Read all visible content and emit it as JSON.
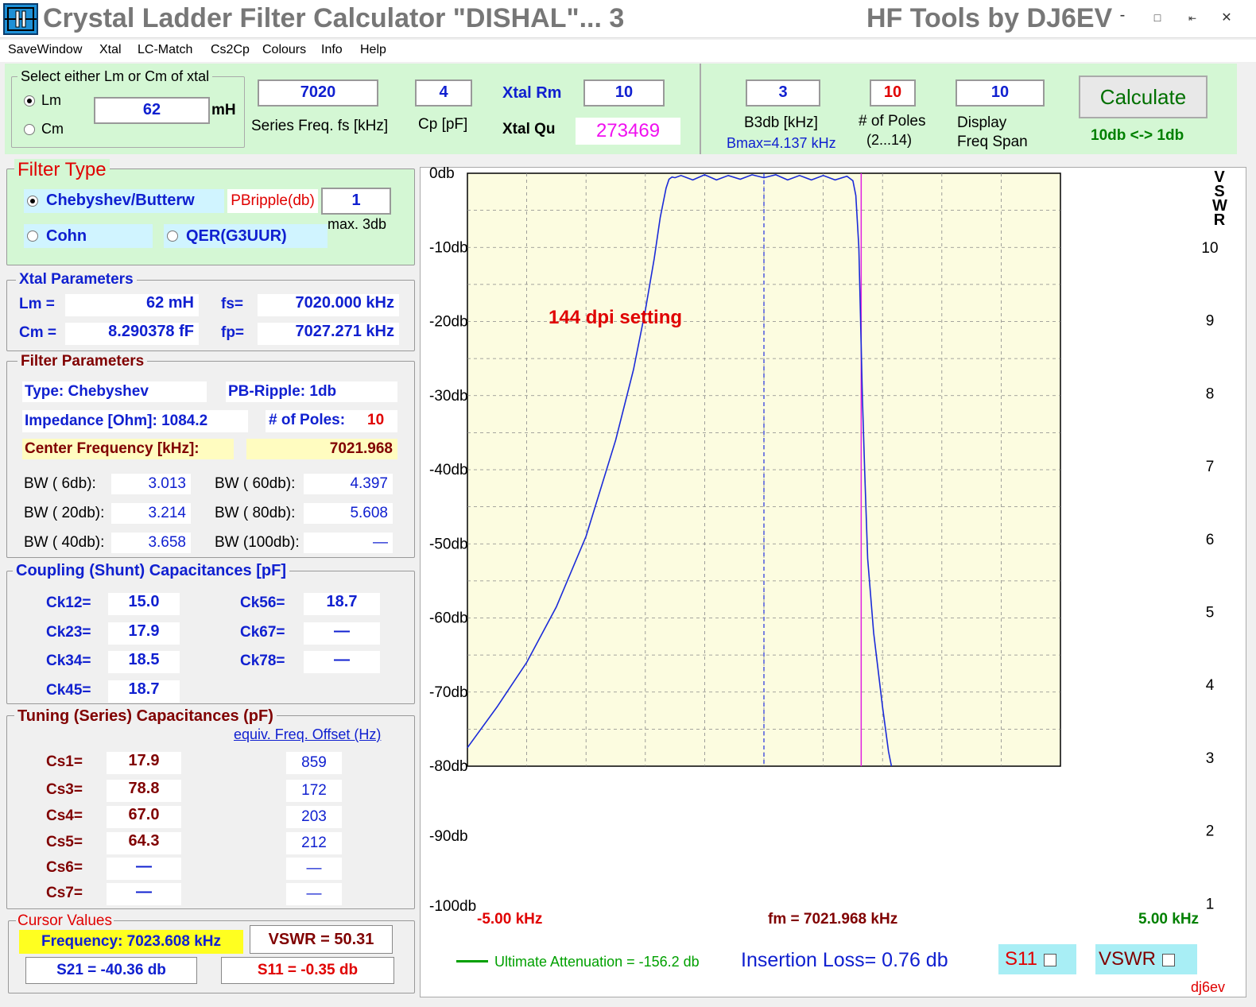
{
  "window": {
    "title": "Crystal Ladder Filter Calculator  \"DISHAL\"... 3",
    "brand": "HF Tools by DJ6EV",
    "controls": [
      "-",
      "□",
      "–—",
      "×"
    ]
  },
  "menu": [
    "SaveWindow",
    "Xtal",
    "LC-Match",
    "Cs2Cp",
    "Colours",
    "Info",
    "Help"
  ],
  "xtal_select": {
    "group_title": "Select either Lm or Cm of xtal",
    "lm_label": "Lm",
    "cm_label": "Cm",
    "lm_value": "62",
    "unit": "mH"
  },
  "inputs": {
    "fs_value": "7020",
    "fs_label": "Series Freq. fs [kHz]",
    "cp_value": "4",
    "cp_label": "Cp [pF]",
    "rm_label": "Xtal Rm",
    "rm_value": "10",
    "qu_label": "Xtal Qu",
    "qu_value": "273469",
    "b3db_value": "3",
    "b3db_label": "B3db [kHz]",
    "bmax": "Bmax=4.137 kHz",
    "poles_value": "10",
    "poles_label": "# of Poles",
    "poles_range": "(2...14)",
    "span_value": "10",
    "span_label1": "Display",
    "span_label2": "Freq  Span",
    "calculate": "Calculate",
    "toggle": "10db <-> 1db"
  },
  "filter_type": {
    "title": "Filter Type",
    "chebyshev": "Chebyshev/Butterw",
    "ripple_label": "PBripple(db)",
    "ripple_value": "1",
    "max_note": "max. 3db",
    "cohn": "Cohn",
    "qer": "QER(G3UUR)"
  },
  "xtal_params": {
    "title": "Xtal Parameters",
    "lm_label": "Lm =",
    "lm_value": "62 mH",
    "fs_label": "fs=",
    "fs_value": "7020.000 kHz",
    "cm_label": "Cm =",
    "cm_value": "8.290378  fF",
    "fp_label": "fp=",
    "fp_value": "7027.271 kHz"
  },
  "filter_params": {
    "title": "Filter Parameters",
    "type": "Type:   Chebyshev",
    "ripple": "PB-Ripple: 1db",
    "impedance": "Impedance [Ohm]:  1084.2",
    "poles_label": "# of Poles:",
    "poles_value": "10",
    "center_label": "Center Frequency [kHz]:",
    "center_value": "7021.968",
    "bw": [
      {
        "label": "BW (  6db):",
        "value": "3.013"
      },
      {
        "label": "BW ( 60db):",
        "value": "4.397"
      },
      {
        "label": "BW ( 20db):",
        "value": "3.214"
      },
      {
        "label": "BW ( 80db):",
        "value": "5.608"
      },
      {
        "label": "BW ( 40db):",
        "value": "3.658"
      },
      {
        "label": "BW (100db):",
        "value": "—"
      }
    ]
  },
  "coupling": {
    "title": "Coupling (Shunt) Capacitances [pF]",
    "items": [
      {
        "label": "Ck12=",
        "value": "15.0"
      },
      {
        "label": "Ck56=",
        "value": "18.7"
      },
      {
        "label": "Ck23=",
        "value": "17.9"
      },
      {
        "label": "Ck67=",
        "value": "—"
      },
      {
        "label": "Ck34=",
        "value": "18.5"
      },
      {
        "label": "Ck78=",
        "value": "—"
      },
      {
        "label": "Ck45=",
        "value": "18.7"
      }
    ]
  },
  "tuning": {
    "title": "Tuning (Series) Capacitances (pF)",
    "offset_link": "equiv. Freq. Offset (Hz)",
    "items": [
      {
        "label": "Cs1=",
        "value": "17.9",
        "offset": "859"
      },
      {
        "label": "Cs3=",
        "value": "78.8",
        "offset": "172"
      },
      {
        "label": "Cs4=",
        "value": "67.0",
        "offset": "203"
      },
      {
        "label": "Cs5=",
        "value": "64.3",
        "offset": "212"
      },
      {
        "label": "Cs6=",
        "value": "—",
        "offset": "—"
      },
      {
        "label": "Cs7=",
        "value": "—",
        "offset": "—"
      }
    ]
  },
  "cursor": {
    "title": "Cursor Values",
    "frequency": "Frequency: 7023.608 kHz",
    "vswr": "VSWR = 50.31",
    "s21": "S21 =  -40.36 db",
    "s11": "S11 =  -0.35 db"
  },
  "graph": {
    "annotation": "144 dpi setting",
    "left_freq": "-5.00 kHz",
    "center_freq": "fm = 7021.968 kHz",
    "right_freq": "5.00 kHz",
    "ultimate": "Ultimate Attenuation = -156.2 db",
    "insertion_loss": "Insertion Loss= 0.76 db",
    "s11_label": "S11",
    "vswr_label": "VSWR",
    "vswr_axis": "VSWR",
    "signature": "dj6ev",
    "colors": {
      "curve": "#1a2ad8",
      "plot_bg": "#fcfce0",
      "grid": "#888888",
      "cursor": "#e020e0",
      "ultimate": "#00a000"
    }
  },
  "chart_data": {
    "type": "line",
    "title": "",
    "xlabel": "",
    "ylabel": "",
    "ylim": [
      -100,
      0
    ],
    "xlim": [
      -5,
      5
    ],
    "y_ticks": [
      "0db",
      "-10db",
      "-20db",
      "-30db",
      "-40db",
      "-50db",
      "-60db",
      "-70db",
      "-80db",
      "-90db",
      "-100db"
    ],
    "y2_ticks": [
      "10",
      "9",
      "8",
      "7",
      "6",
      "5",
      "4",
      "3",
      "2",
      "1"
    ],
    "series": [
      {
        "x": [
          -5.0,
          -4.5,
          -4.0,
          -3.5,
          -3.0,
          -2.5,
          -2.2,
          -2.0,
          -1.85,
          -1.75,
          -1.65,
          -1.6,
          -1.55,
          -1.5,
          -1.4,
          -1.2,
          -1.0,
          -0.8,
          -0.6,
          -0.4,
          -0.2,
          0.0,
          0.2,
          0.4,
          0.6,
          0.8,
          1.0,
          1.2,
          1.4,
          1.5,
          1.55,
          1.6,
          1.63,
          1.66,
          1.7,
          1.75,
          1.85,
          2.0,
          2.1,
          2.15
        ],
        "y": [
          -77.5,
          -72,
          -66,
          -58.5,
          -49,
          -36,
          -26.5,
          -18.5,
          -11.5,
          -6,
          -2,
          -0.8,
          -0.5,
          -0.6,
          -0.3,
          -0.9,
          -0.2,
          -0.9,
          -0.3,
          -0.8,
          -0.2,
          -0.6,
          -0.2,
          -0.9,
          -0.3,
          -0.9,
          -0.3,
          -0.9,
          -0.4,
          -1.0,
          -3,
          -10,
          -20,
          -30,
          -40.36,
          -52,
          -62,
          -72,
          -78,
          -80
        ]
      }
    ],
    "center_marker_khz": 0,
    "cursor_khz": 1.64
  }
}
